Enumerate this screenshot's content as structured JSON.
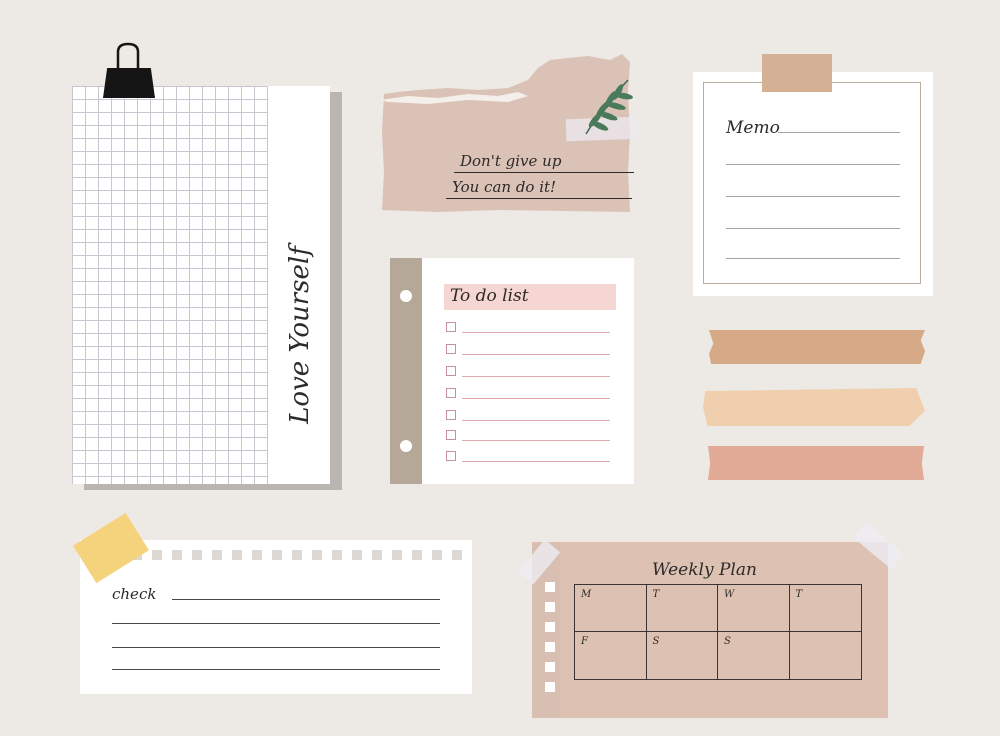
{
  "grid_note": {
    "text": "Love Yourself"
  },
  "quote_note": {
    "line1": "Don't give up",
    "line2": "You can do it!"
  },
  "memo_note": {
    "title": "Memo"
  },
  "todo_note": {
    "title": "To do list",
    "item_count": 7
  },
  "check_note": {
    "title": "check"
  },
  "weekly_note": {
    "title": "Weekly Plan",
    "days": [
      "M",
      "T",
      "W",
      "T",
      "F",
      "S",
      "S",
      ""
    ]
  },
  "stock_id": "436960478",
  "colors": {
    "background": "#ede9e4",
    "tape_caramel": "#d6aa87",
    "tape_peach": "#f0cfae",
    "tape_rose": "#e1ab96",
    "washi_yellow": "#f5d37d",
    "dusty_pink": "#ddc2b4",
    "todo_highlight": "#f6d6d2"
  }
}
